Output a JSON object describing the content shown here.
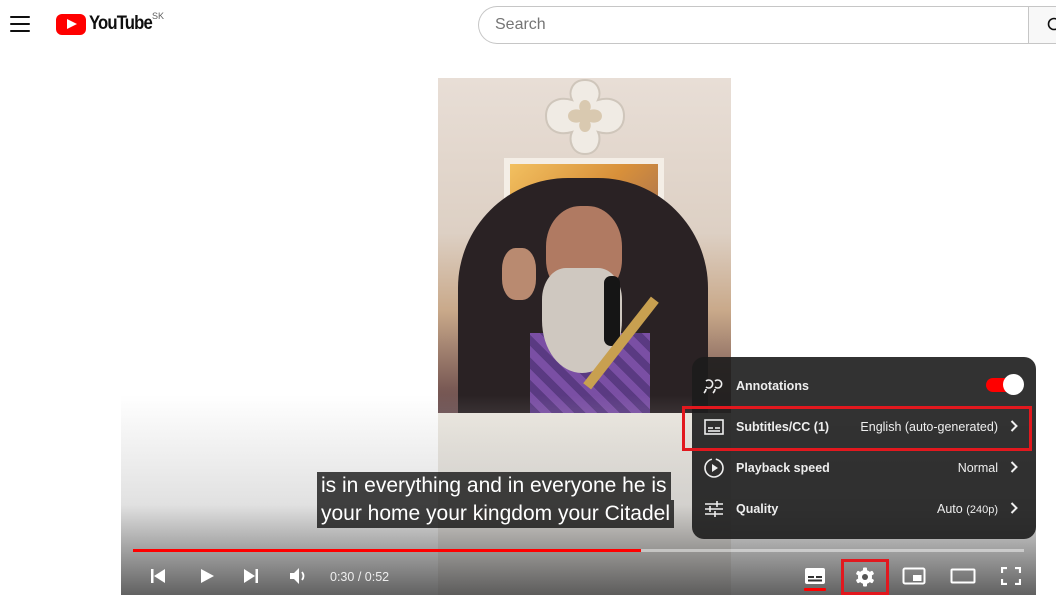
{
  "header": {
    "logo_text": "YouTube",
    "region": "SK",
    "search_placeholder": "Search"
  },
  "player": {
    "subtitles": [
      "is in everything and in everyone he is",
      "your home your kingdom your Citadel"
    ],
    "progress_fraction": 0.57,
    "time": {
      "current": "0:30",
      "separator": " / ",
      "duration": "0:52"
    },
    "settings_menu": {
      "annotations": {
        "label": "Annotations",
        "enabled": true
      },
      "subtitles": {
        "label": "Subtitles/CC (1)",
        "value": "English (auto-generated)"
      },
      "playback_speed": {
        "label": "Playback speed",
        "value": "Normal"
      },
      "quality": {
        "label": "Quality",
        "value": "Auto",
        "value_detail": "(240p)"
      }
    }
  },
  "colors": {
    "accent": "#ff0000",
    "highlight_box": "#e2181e",
    "menu_bg": "#1c1c1c"
  }
}
